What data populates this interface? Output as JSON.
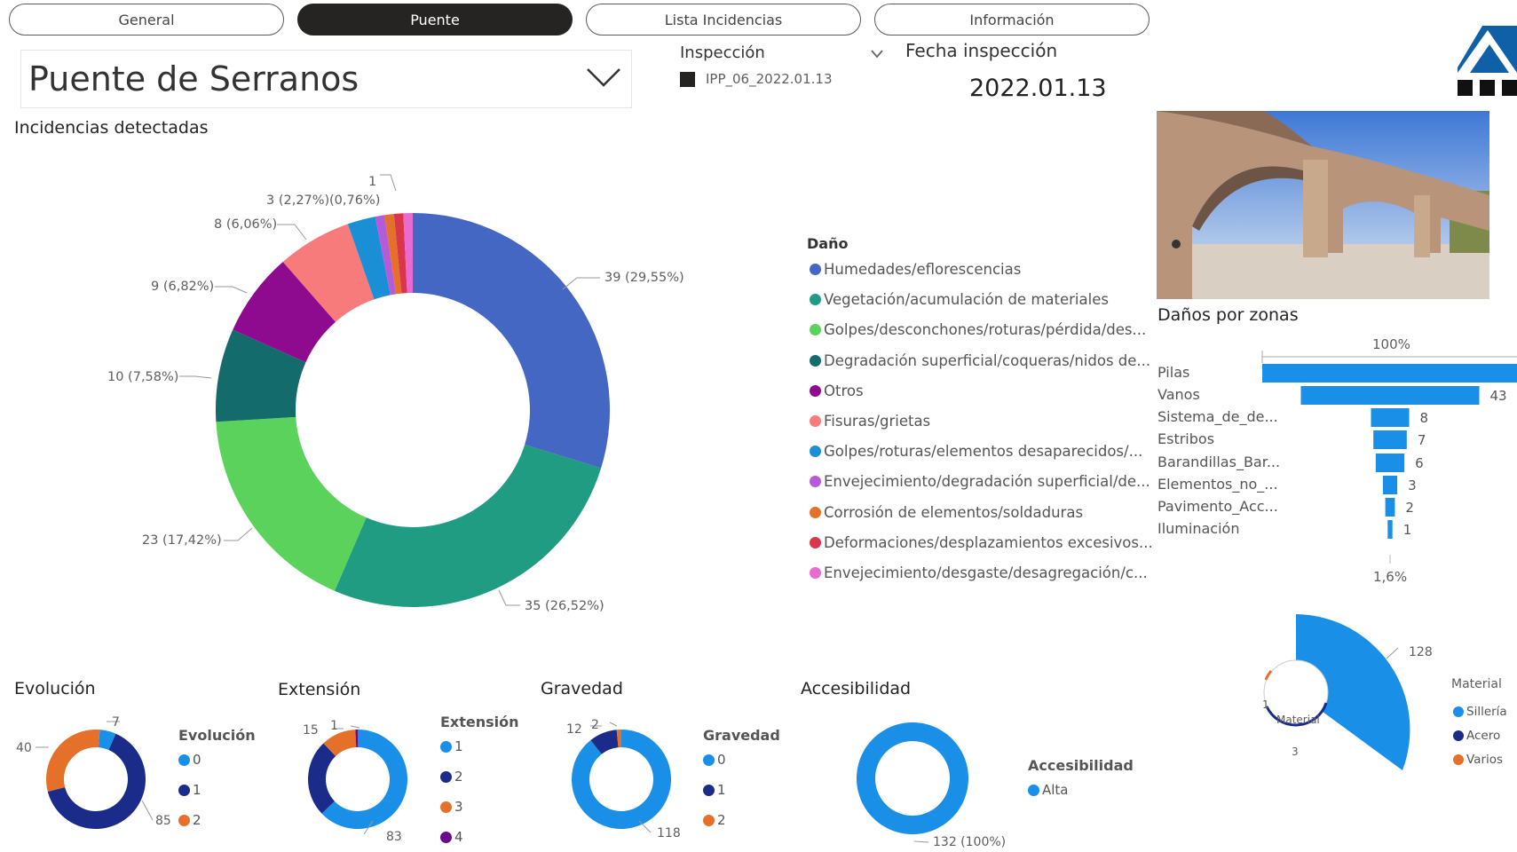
{
  "tabs": [
    {
      "label": "General",
      "active": false
    },
    {
      "label": "Puente",
      "active": true
    },
    {
      "label": "Lista Incidencias",
      "active": false
    },
    {
      "label": "Información",
      "active": false
    }
  ],
  "bridge_select": {
    "value": "Puente de Serranos"
  },
  "inspection": {
    "label": "Inspección",
    "item": "IPP_06_2022.01.13"
  },
  "fecha": {
    "label": "Fecha inspección",
    "value": "2022.01.13"
  },
  "incidencias": {
    "title": "Incidencias detectadas",
    "legend_title": "Daño",
    "legend": [
      {
        "label": "Humedades/eflorescencias",
        "color": "#4467c4"
      },
      {
        "label": "Vegetación/acumulación de materiales",
        "color": "#1f9c82"
      },
      {
        "label": "Golpes/desconchones/roturas/pérdida/des...",
        "color": "#5bd25b"
      },
      {
        "label": "Degradación superficial/coqueras/nidos de...",
        "color": "#136b6b"
      },
      {
        "label": "Otros",
        "color": "#8e0a8e"
      },
      {
        "label": "Fisuras/grietas",
        "color": "#f77b7b"
      },
      {
        "label": "Golpes/roturas/elementos desaparecidos/...",
        "color": "#1a8fd6"
      },
      {
        "label": "Envejecimiento/degradación superficial/de...",
        "color": "#b65bd8"
      },
      {
        "label": "Corrosión de elementos/soldaduras",
        "color": "#e4702a"
      },
      {
        "label": "Deformaciones/desplazamientos excesivos...",
        "color": "#d9364a"
      },
      {
        "label": "Envejecimiento/desgaste/desagregación/c...",
        "color": "#e86bd2"
      }
    ],
    "slice_labels": [
      "39 (29,55%)",
      "35 (26,52%)",
      "23 (17,42%)",
      "10 (7,58%)",
      "9 (6,82%)",
      "8 (6,06%)",
      "3 (2,27%)",
      "(0,76%)",
      "1"
    ]
  },
  "photo": {
    "description": "bridge-photo"
  },
  "zonas": {
    "title": "Daños por zonas",
    "top_label": "100%",
    "bottom_label": "1,6%",
    "value_43": "43",
    "value_8": "8",
    "value_7": "7",
    "value_6": "6",
    "value_3": "3",
    "value_2": "2",
    "value_1": "1"
  },
  "bottom": {
    "evolucion": {
      "title": "Evolución",
      "legend_title": "Evolución",
      "legend": [
        "0",
        "1",
        "2"
      ],
      "labels": [
        "7",
        "40",
        "85"
      ]
    },
    "extension": {
      "title": "Extensión",
      "legend_title": "Extensión",
      "legend": [
        "1",
        "2",
        "3",
        "4"
      ],
      "labels": [
        "15",
        "1",
        "83"
      ]
    },
    "gravedad": {
      "title": "Gravedad",
      "legend_title": "Gravedad",
      "legend": [
        "0",
        "1",
        "2"
      ],
      "labels": [
        "12",
        "2",
        "118"
      ]
    },
    "accesibilidad": {
      "title": "Accesibilidad",
      "legend_title": "Accesibilidad",
      "legend": [
        "Alta"
      ],
      "labels": [
        "132 (100%)"
      ]
    }
  },
  "material": {
    "center": "Material",
    "legend_title": "Material",
    "legend": [
      "Sillería",
      "Acero",
      "Varios"
    ],
    "labels": [
      "128",
      "1",
      "3"
    ]
  },
  "chart_data": [
    {
      "type": "pie",
      "title": "Incidencias detectadas",
      "categories": [
        "Humedades/eflorescencias",
        "Vegetación/acumulación de materiales",
        "Golpes/desconchones/roturas/pérdida/des...",
        "Degradación superficial/coqueras/nidos de...",
        "Otros",
        "Fisuras/grietas",
        "Golpes/roturas/elementos desaparecidos/...",
        "Envejecimiento/degradación superficial/de...",
        "Corrosión de elementos/soldaduras",
        "Deformaciones/desplazamientos excesivos...",
        "Envejecimiento/desgaste/desagregación/c..."
      ],
      "values": [
        39,
        35,
        23,
        10,
        9,
        8,
        3,
        1,
        1,
        1,
        1
      ]
    },
    {
      "type": "bar",
      "title": "Daños por zonas",
      "categories": [
        "Pilas",
        "Vanos",
        "Sistema_de_de...",
        "Estribos",
        "Barandillas_Bar...",
        "Elementos_no_...",
        "Pavimento_Acc...",
        "Iluminación"
      ],
      "values": [
        62,
        43,
        8,
        7,
        6,
        3,
        2,
        1
      ]
    },
    {
      "type": "pie",
      "title": "Evolución",
      "categories": [
        "0",
        "1",
        "2"
      ],
      "values": [
        7,
        85,
        40
      ]
    },
    {
      "type": "pie",
      "title": "Extensión",
      "categories": [
        "1",
        "2",
        "3",
        "4"
      ],
      "values": [
        83,
        33,
        15,
        1
      ]
    },
    {
      "type": "pie",
      "title": "Gravedad",
      "categories": [
        "0",
        "1",
        "2"
      ],
      "values": [
        118,
        12,
        2
      ]
    },
    {
      "type": "pie",
      "title": "Accesibilidad",
      "categories": [
        "Alta"
      ],
      "values": [
        132
      ]
    },
    {
      "type": "pie",
      "title": "Material",
      "categories": [
        "Sillería",
        "Acero",
        "Varios"
      ],
      "values": [
        128,
        1,
        3
      ]
    }
  ]
}
